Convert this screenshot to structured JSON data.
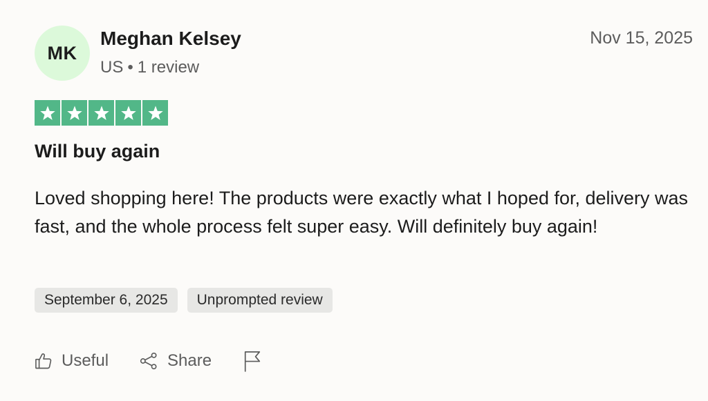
{
  "reviewer": {
    "initials": "MK",
    "name": "Meghan Kelsey",
    "country": "US",
    "separator": "•",
    "review_count": "1 review",
    "avatar_color": "#dcf9da"
  },
  "review": {
    "date": "Nov 15, 2025",
    "rating": 5,
    "rating_max": 5,
    "star_color": "#52b788",
    "title": "Will buy again",
    "body": "Loved shopping here! The products were exactly what I hoped for, delivery was fast, and the whole process felt super easy. Will definitely buy again!",
    "tags": [
      {
        "label": "September 6, 2025"
      },
      {
        "label": "Unprompted review"
      }
    ]
  },
  "actions": {
    "useful_label": "Useful",
    "useful_icon": "thumbs-up-icon",
    "share_label": "Share",
    "share_icon": "share-icon",
    "report_icon": "flag-icon"
  }
}
